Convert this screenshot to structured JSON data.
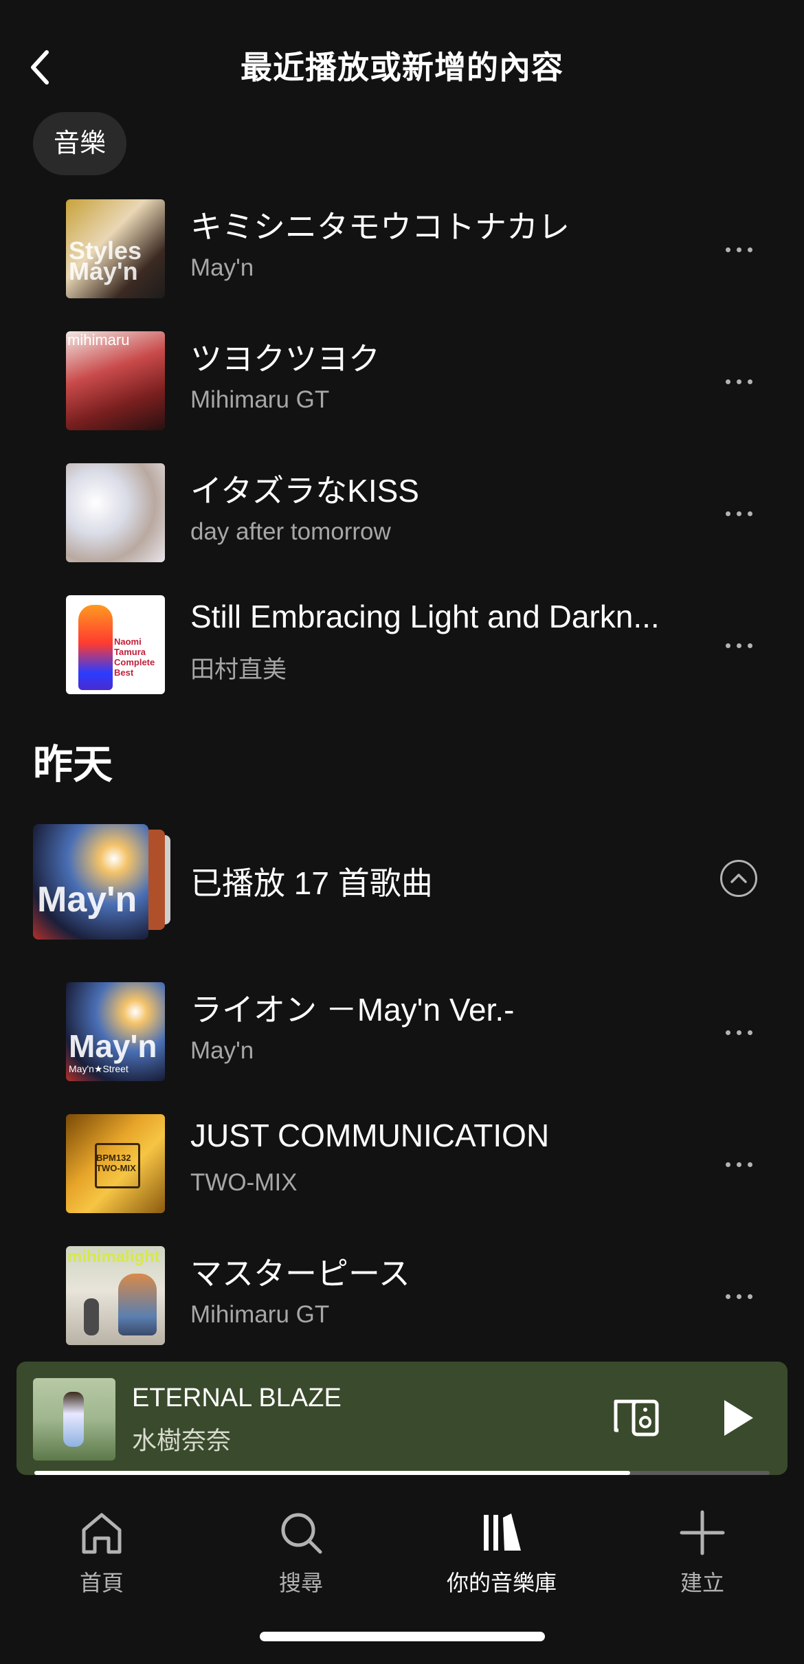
{
  "header": {
    "title": "最近播放或新增的內容",
    "back_icon": "chevron-left-icon"
  },
  "filter_chip": {
    "label": "音樂"
  },
  "tracks_recent": [
    {
      "title": "キミシニタモウコトナカレ",
      "artist": "May'n"
    },
    {
      "title": "ツヨクツヨク",
      "artist": "Mihimaru GT"
    },
    {
      "title": "イタズラなKISS",
      "artist": "day after tomorrow"
    },
    {
      "title": "Still Embracing Light and Darkn...",
      "artist": "田村直美"
    }
  ],
  "section": {
    "title": "昨天"
  },
  "group": {
    "title": "已播放 17 首歌曲",
    "collapse_icon": "chevron-up-circle-icon"
  },
  "tracks_yesterday": [
    {
      "title": "ライオン －May'n Ver.-",
      "artist": "May'n"
    },
    {
      "title": "JUST COMMUNICATION",
      "artist": "TWO-MIX"
    },
    {
      "title": "マスターピース",
      "artist": "Mihimaru GT"
    }
  ],
  "cover_text": {
    "styles_mayn": "Styles May'n",
    "mihimaru": "mihimaru",
    "naomi": "Naomi Tamura Complete Best",
    "mayn_street": "May'n",
    "mayn_street_sub": "May'n★Street",
    "bpm": "BPM132 TWO-MIX",
    "mihimalight": "mihimalight"
  },
  "now_playing": {
    "title": "ETERNAL BLAZE",
    "artist": "水樹奈奈",
    "progress": 0.81,
    "colors": {
      "background": "#3a4a2c"
    }
  },
  "tabs": [
    {
      "label": "首頁",
      "icon": "home-icon",
      "active": false
    },
    {
      "label": "搜尋",
      "icon": "search-icon",
      "active": false
    },
    {
      "label": "你的音樂庫",
      "icon": "library-icon",
      "active": true
    },
    {
      "label": "建立",
      "icon": "plus-icon",
      "active": false
    }
  ]
}
